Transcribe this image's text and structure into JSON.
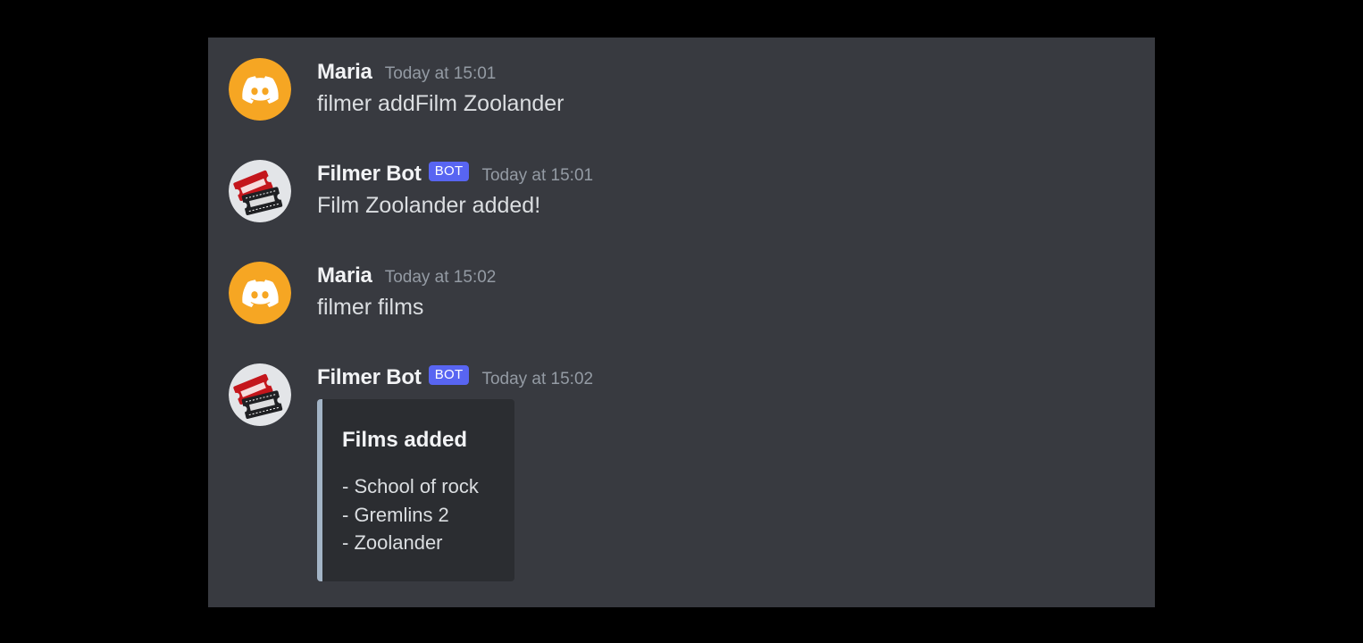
{
  "colors": {
    "background": "#000000",
    "chat_background": "#383a40",
    "author_name": "#f2f3f5",
    "message_text": "#dbdee1",
    "timestamp": "#949ba4",
    "bot_tag": "#5865f2",
    "embed_background": "#2b2d31",
    "embed_accent": "#a3b4c6",
    "discord_avatar": "#f6a623"
  },
  "messages": [
    {
      "author": "Maria",
      "avatar_icon": "discord-logo-icon",
      "timestamp": "Today at 15:01",
      "text": "filmer addFilm Zoolander"
    },
    {
      "author": "Filmer Bot",
      "bot_tag": "BOT",
      "avatar_icon": "film-tickets-icon",
      "timestamp": "Today at 15:01",
      "text": "Film Zoolander added!"
    },
    {
      "author": "Maria",
      "avatar_icon": "discord-logo-icon",
      "timestamp": "Today at 15:02",
      "text": "filmer films"
    },
    {
      "author": "Filmer Bot",
      "bot_tag": "BOT",
      "avatar_icon": "film-tickets-icon",
      "timestamp": "Today at 15:02",
      "embed": {
        "title": "Films added",
        "items": [
          "- School of rock",
          "- Gremlins 2",
          "- Zoolander"
        ]
      }
    }
  ]
}
